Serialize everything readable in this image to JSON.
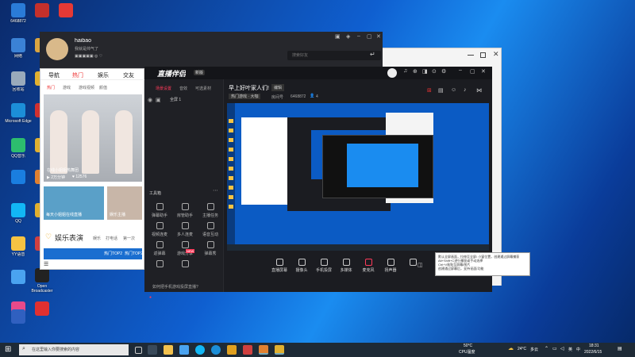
{
  "desktop": {
    "icons": [
      {
        "label": "6468872",
        "color": "#2a7bd8"
      },
      {
        "label": "",
        "color": "#c4302b"
      },
      {
        "label": "",
        "color": "#e53935"
      },
      {
        "label": "网络",
        "color": "#3b82d6"
      },
      {
        "label": "",
        "color": "#d9a441"
      },
      {
        "label": "回收站",
        "color": "#9ab"
      },
      {
        "label": "",
        "color": "#e0b030"
      },
      {
        "label": "Microsoft Edge",
        "color": "#1c8ed8"
      },
      {
        "label": "",
        "color": "#d03030"
      },
      {
        "label": "QQ音乐",
        "color": "#2dbd6e"
      },
      {
        "label": "",
        "color": "#e0b030"
      },
      {
        "label": "",
        "color": "#1a7ee0"
      },
      {
        "label": "",
        "color": "#e08030"
      },
      {
        "label": "QQ",
        "color": "#12b7f5"
      },
      {
        "label": "",
        "color": "#e0b030"
      },
      {
        "label": "YY语音",
        "color": "#f6c343"
      },
      {
        "label": "",
        "color": "#d04040"
      },
      {
        "label": "",
        "color": "#4aa3f0"
      },
      {
        "label": "Open Broadcaster",
        "color": "#222"
      },
      {
        "label": "",
        "color": "#e84a8a"
      },
      {
        "label": "",
        "color": "#e03030"
      },
      {
        "label": "",
        "color": "#3060c0"
      }
    ]
  },
  "left_window": {
    "nav": [
      "导航",
      "热门",
      "娱乐",
      "交友"
    ],
    "subnav": [
      "热门",
      "游戏",
      "游戏视频",
      "颜值"
    ],
    "card1": {
      "title": "在线小姐姐热舞团",
      "meta1": "▶ 2万分钟",
      "meta2": "♥ 12576"
    },
    "card2": {
      "title": "每天小姐姐在线直播",
      "title2": "娱乐主播"
    },
    "section": "娱乐表演",
    "section_links": [
      "娱乐",
      "打电话",
      "第一次"
    ],
    "footer1": "热门TOP2",
    "footer2": "热门TOP2"
  },
  "profile": {
    "name": "haibao",
    "status": "我就是帅气了",
    "search_placeholder": "搜索好友"
  },
  "app": {
    "logo": "直播伴侣",
    "version": "新版",
    "tabs": [
      "场景设置",
      "音效",
      "可选素材"
    ],
    "scene": "全屏 1",
    "toolbox": "工具箱",
    "tools": [
      "弹幕助手",
      "房管助手",
      "主播任务",
      "视频连麦",
      "多人连麦",
      "语音互动",
      "返弹幕",
      "游戏分享",
      "弹幕秀",
      "",
      ""
    ],
    "tool_badge": "NEW",
    "bottom_note": "如何把手机游戏投屏直播?",
    "stream_title": "早上好叶家人们!",
    "edit": "编辑",
    "tag": "热门游戏 · 大咖",
    "room": "房间号",
    "room_id": "6468872",
    "fans": "4",
    "controls": [
      "直播屏幕",
      "摄像头",
      "手机投屏",
      "多媒体",
      "麦克风",
      "扬声器",
      ""
    ]
  },
  "tooltip": {
    "lines": [
      "默认全屏画面，拉伸至全屏/ 小窗位置，创建通过屏幕捕获Alt+Shift+C进行捕获或手动选择",
      "Ctrl+V粘贴至屏幕/图片",
      "创建通过屏幕后，支持'画面'功能"
    ]
  },
  "taskbar": {
    "search_placeholder": "在这里输入你要搜索的内容",
    "weather_temp": "50°C",
    "weather_label": "CPU温度",
    "temp": "24°C",
    "condition": "多云",
    "lang": "英",
    "ime": "中",
    "time": "18:31",
    "date": "2022/6/15"
  }
}
